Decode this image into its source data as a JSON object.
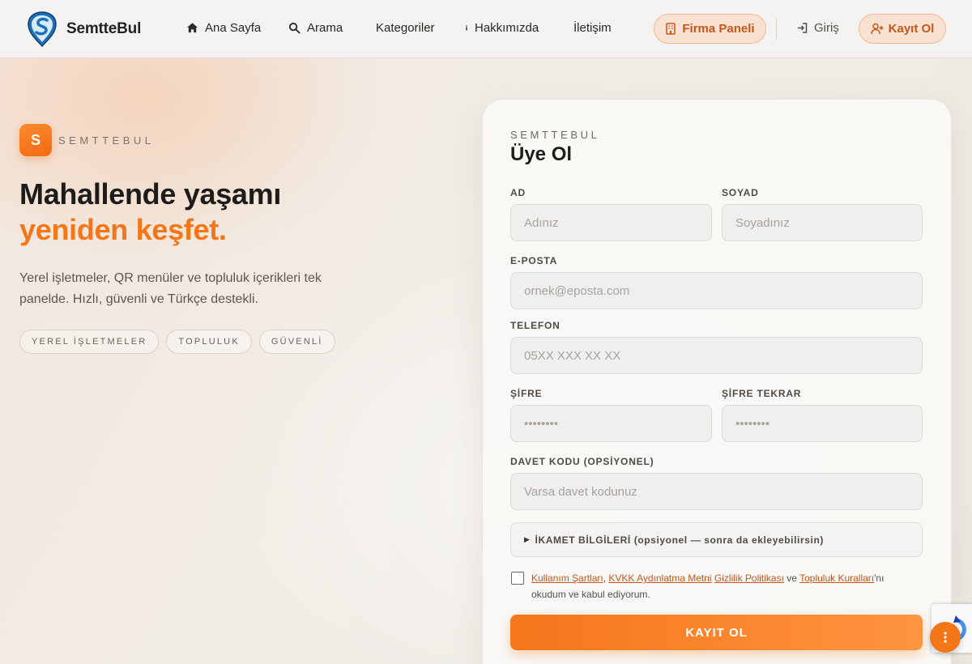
{
  "header": {
    "brand": "SemtteBul",
    "nav": [
      {
        "label": "Ana Sayfa",
        "icon": "home-icon"
      },
      {
        "label": "Arama",
        "icon": "search-icon"
      },
      {
        "label": "Kategoriler",
        "icon": ""
      },
      {
        "label": "Hakkımızda",
        "icon": "info-icon"
      },
      {
        "label": "İletişim",
        "icon": ""
      }
    ],
    "firm_panel_label": "Firma Paneli",
    "login_label": "Giriş",
    "register_label": "Kayıt Ol"
  },
  "hero": {
    "badge_letter": "S",
    "badge_label": "SEMTTEBUL",
    "title_line1": "Mahallende yaşamı",
    "title_line2": "yeniden keşfet.",
    "description": "Yerel işletmeler, QR menüler ve topluluk içerikleri tek panelde. Hızlı, güvenli ve Türkçe destekli.",
    "chips": [
      "YEREL İŞLETMELER",
      "TOPLULUK",
      "GÜVENLİ"
    ]
  },
  "form": {
    "kicker": "SEMTTEBUL",
    "title": "Üye Ol",
    "first_name": {
      "label": "AD",
      "placeholder": "Adınız"
    },
    "last_name": {
      "label": "SOYAD",
      "placeholder": "Soyadınız"
    },
    "email": {
      "label": "E-POSTA",
      "placeholder": "ornek@eposta.com"
    },
    "phone": {
      "label": "TELEFON",
      "placeholder": "05XX XXX XX XX"
    },
    "password": {
      "label": "ŞİFRE",
      "placeholder": "••••••••"
    },
    "password_repeat": {
      "label": "ŞİFRE TEKRAR",
      "placeholder": "••••••••"
    },
    "invite": {
      "label": "DAVET KODU (OPSİYONEL)",
      "placeholder": "Varsa davet kodunuz"
    },
    "residence_details": "İKAMET BİLGİLERİ (opsiyonel — sonra da ekleyebilirsin)",
    "terms": {
      "link1": "Kullanım Şartları",
      "sep1": ",",
      "link2": "KVKK Aydınlatma Metni",
      "link3": "Gizlilik Politikası",
      "and": "ve",
      "link4": "Topluluk Kuralları",
      "suffix": "'nı okudum ve kabul ediyorum."
    },
    "submit_label": "KAYIT OL"
  },
  "colors": {
    "accent": "#f47619",
    "accent_dark": "#c4561a",
    "accent_light": "#fae2d2"
  }
}
